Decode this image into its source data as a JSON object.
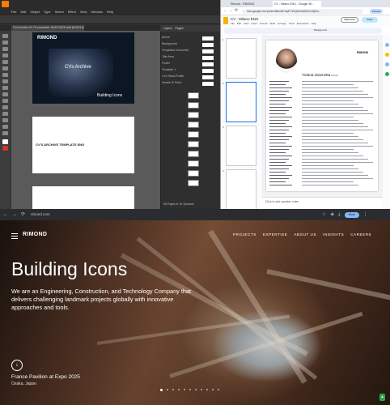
{
  "illustrator": {
    "menu": [
      "File",
      "Edit",
      "Object",
      "Type",
      "Select",
      "Effect",
      "View",
      "Window",
      "Help"
    ],
    "doc_tab": "CVs Archive 02.79 concentric 28.63 2023.indd @ 50% (RGB/GPU Preview)",
    "panel_tabs": [
      "Layers",
      "Pages"
    ],
    "layers": [
      "Above",
      "Background",
      "Templates Horizontal",
      "Title Area",
      "Footer",
      "Template 1",
      "CVs Head-Profile",
      "Header Ill Parts"
    ],
    "artboard1": {
      "logo": "RIMOND",
      "title": "CVs Archive",
      "subtitle": "Building Icons"
    },
    "artboard2": {
      "text": "CV'S ARCHIVE TEMPLATE ENG"
    },
    "status": "56 Pages in 16 Spreads"
  },
  "chrome_slides": {
    "tabs": [
      "Rimond - RIMOND",
      "CV - Milano ENG - Google Sli..."
    ],
    "url": "docs.google.com/presentation/d/1bpPr-5VQb1HsQ0GCn4IjOm...",
    "profile": "Paused",
    "doc_title": "CV - Milano ENG",
    "menu": [
      "File",
      "Edit",
      "View",
      "Insert",
      "Format",
      "Slide",
      "Arrange",
      "Tools",
      "Extensions",
      "Help"
    ],
    "slideshow": "Slideshow",
    "share": "Share",
    "background_btn": "Background",
    "slide_numbers": [
      "1",
      "2",
      "3",
      "4"
    ],
    "slide": {
      "person_name": "Tiziana Giannetta",
      "role": "MArch",
      "logo": "RIMOND"
    },
    "notes_placeholder": "Click to add speaker notes"
  },
  "website": {
    "url": "rimond.com",
    "profile": "Work",
    "logo": "RIMOND",
    "nav": [
      "PROJECTS",
      "EXPERTISE",
      "ABOUT US",
      "INSIGHTS",
      "CAREERS"
    ],
    "headline": "Building Icons",
    "subheadline": "We are an Engineering, Construction, and Technology Company that delivers challenging landmark projects globally with innovative approaches and tools.",
    "caption_title": "France Pavilion at Expo 2025",
    "caption_location": "Osaka, Japan",
    "slider_count": 11,
    "slider_active": 0
  }
}
